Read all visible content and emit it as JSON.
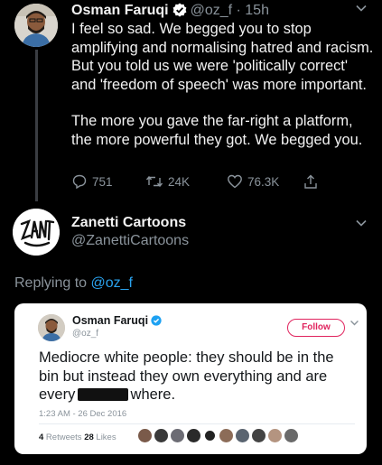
{
  "tweet": {
    "author_name": "Osman Faruqi",
    "author_handle": "@oz_f",
    "time": "15h",
    "separator": " · ",
    "paragraph_1": "I feel so sad. We begged you to stop amplifying and normalising hatred and racism. But you told us we were 'politically correct' and 'freedom of speech' was more important.",
    "paragraph_2": "The more you gave the far-right a platform, the more powerful they got. We begged you.",
    "reply_count": "751",
    "retweet_count": "24K",
    "like_count": "76.3K"
  },
  "reply": {
    "author_name": "Zanetti Cartoons",
    "author_handle": "@ZanettiCartoons",
    "replying_prefix": "Replying to ",
    "replying_handle": "@oz_f"
  },
  "embedded": {
    "author_name": "Osman Faruqi",
    "author_handle": "@oz_f",
    "follow_label": "Follow",
    "text_before": "Mediocre white people: they should be in the bin but instead they own everything and are every ",
    "text_after": " where.",
    "timestamp": "1:23 AM - 26 Dec 2016",
    "retweets_count": "4",
    "retweets_label": " Retweets ",
    "likes_count": "28",
    "likes_label": " Likes"
  },
  "colors": {
    "background": "#000000",
    "text": "#f2f2f2",
    "muted": "#8a939b",
    "link": "#2aa3ef",
    "verified": "#ffffff",
    "follow": "#e0245e"
  },
  "icons": [
    "chevron-down-icon",
    "verified-icon",
    "reply-icon",
    "retweet-icon",
    "like-icon",
    "share-icon"
  ]
}
